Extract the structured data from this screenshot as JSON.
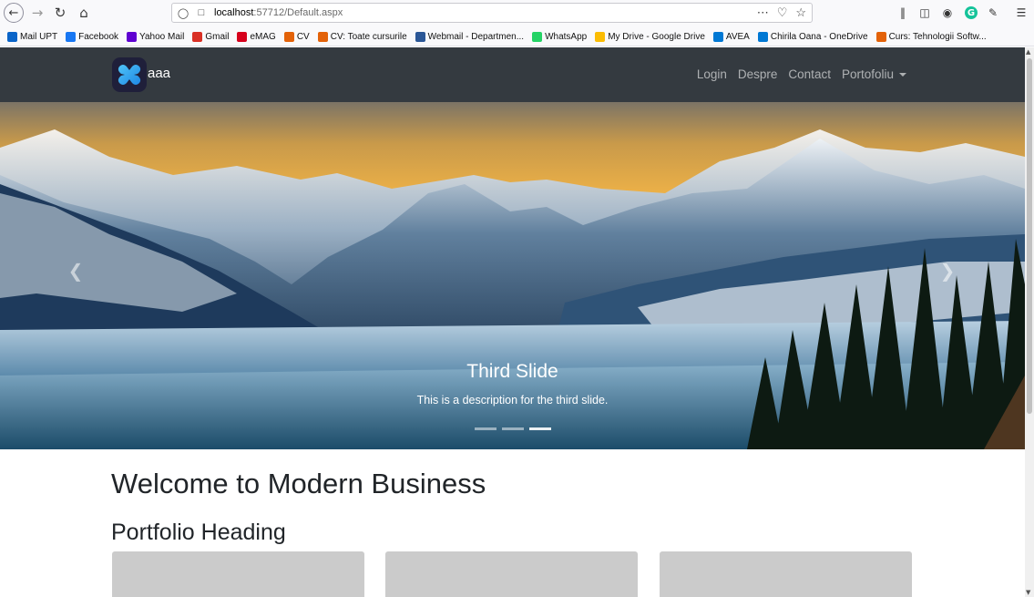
{
  "browser": {
    "url_host": "localhost",
    "url_path": ":57712/Default.aspx",
    "icons": [
      "back-icon",
      "forward-icon",
      "reload-icon",
      "home-icon",
      "shield-icon",
      "page-icon",
      "more-icon",
      "pocket-icon",
      "star-icon",
      "library-icon",
      "sidebar-icon",
      "account-icon",
      "grammarly-icon",
      "extension-icon",
      "menu-icon"
    ]
  },
  "bookmarks": [
    {
      "label": "Mail UPT",
      "color": "#0a64c8"
    },
    {
      "label": "Facebook",
      "color": "#1877f2"
    },
    {
      "label": "Yahoo Mail",
      "color": "#5f01d1"
    },
    {
      "label": "Gmail",
      "color": "#d93025"
    },
    {
      "label": "eMAG",
      "color": "#d6001c"
    },
    {
      "label": "CV",
      "color": "#e36209"
    },
    {
      "label": "CV: Toate cursurile",
      "color": "#e36209"
    },
    {
      "label": "Webmail - Departmen...",
      "color": "#2b5797"
    },
    {
      "label": "WhatsApp",
      "color": "#25d366"
    },
    {
      "label": "My Drive - Google Drive",
      "color": "#fbbc04"
    },
    {
      "label": "AVEA",
      "color": "#0078d4"
    },
    {
      "label": "Chirila Oana - OneDrive",
      "color": "#0078d4"
    },
    {
      "label": "Curs: Tehnologii Softw...",
      "color": "#e36209"
    }
  ],
  "site": {
    "brand": "aaa",
    "nav": {
      "login": "Login",
      "despre": "Despre",
      "contact": "Contact",
      "portofoliu": "Portofoliu"
    },
    "carousel": {
      "title": "Third Slide",
      "description": "This is a description for the third slide.",
      "slide_count": 3,
      "active_index": 2
    },
    "welcome_heading": "Welcome to Modern Business",
    "portfolio_heading": "Portfolio Heading"
  },
  "colors": {
    "navbar_bg": "#343a40",
    "card_bg": "#cbcbcb",
    "text": "#212529"
  }
}
